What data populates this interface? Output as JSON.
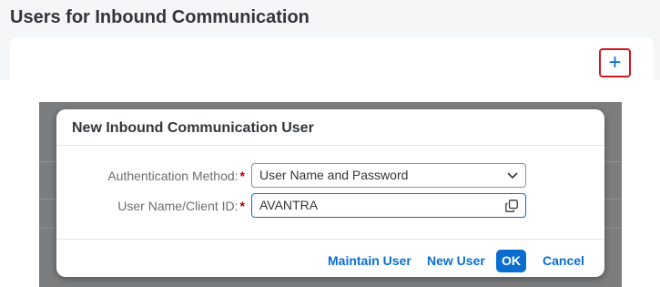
{
  "page": {
    "title": "Users for Inbound Communication"
  },
  "toolbar": {
    "add_icon": "plus-icon",
    "add_glyph": "+"
  },
  "dialog": {
    "title": "New Inbound Communication User",
    "fields": [
      {
        "label": "Authentication Method:",
        "required_mark": "*",
        "value": "User Name and Password",
        "icon": "chevron-down-icon"
      },
      {
        "label": "User Name/Client ID:",
        "required_mark": "*",
        "value": "AVANTRA",
        "icon": "copy-icon"
      }
    ],
    "buttons": {
      "maintain_user": "Maintain User",
      "new_user": "New User",
      "ok": "OK",
      "cancel": "Cancel"
    }
  },
  "colors": {
    "accent": "#0a6ed1",
    "focus_highlight": "#d0161e",
    "required": "#bb0000",
    "overlay": "#7b7d7f"
  }
}
